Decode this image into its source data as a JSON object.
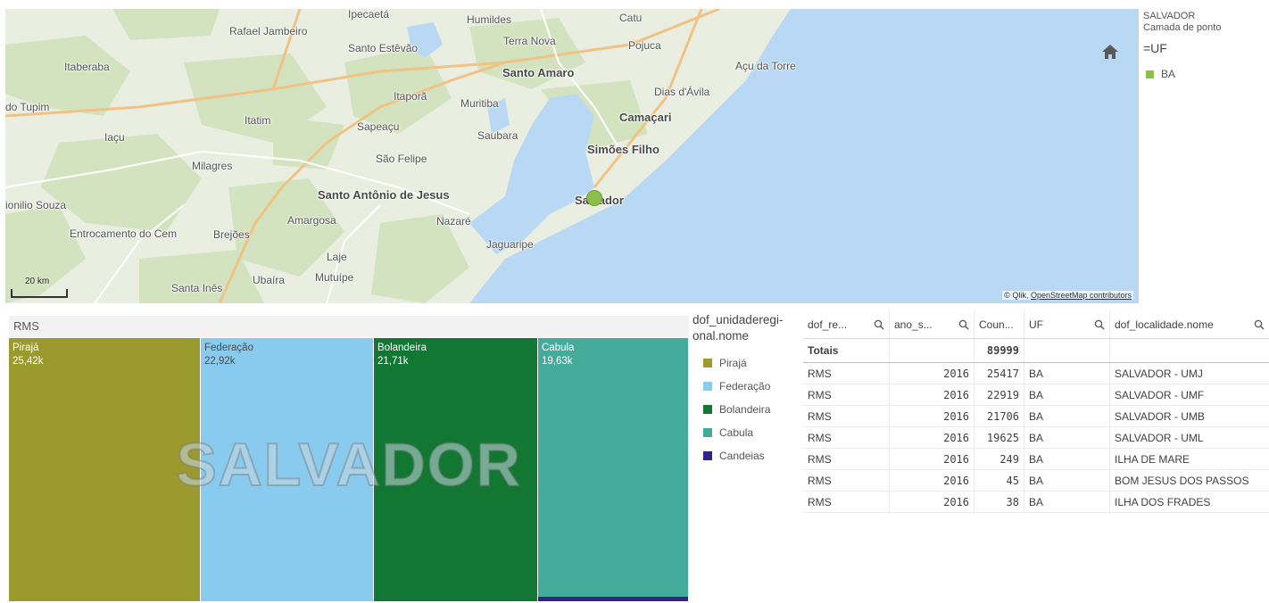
{
  "map": {
    "places": [
      {
        "name": "Ipecaetá",
        "city": false
      },
      {
        "name": "Humildes",
        "city": false
      },
      {
        "name": "Catu",
        "city": false
      },
      {
        "name": "Rafael Jambeiro",
        "city": false
      },
      {
        "name": "Santo Estêvão",
        "city": false
      },
      {
        "name": "Terra Nova",
        "city": false
      },
      {
        "name": "Pojuca",
        "city": false
      },
      {
        "name": "Itaberaba",
        "city": false
      },
      {
        "name": "Santo Amaro",
        "city": true
      },
      {
        "name": "Açu da Torre",
        "city": false
      },
      {
        "name": "Dias d'Ávila",
        "city": false
      },
      {
        "name": "do Tupim",
        "city": false
      },
      {
        "name": "Itaporã",
        "city": false
      },
      {
        "name": "Muritiba",
        "city": false
      },
      {
        "name": "Itatim",
        "city": false
      },
      {
        "name": "Camaçari",
        "city": true
      },
      {
        "name": "Sapeaçu",
        "city": false
      },
      {
        "name": "Iaçu",
        "city": false
      },
      {
        "name": "Saubara",
        "city": false
      },
      {
        "name": "Simões Filho",
        "city": true
      },
      {
        "name": "São Felipe",
        "city": false
      },
      {
        "name": "Milagres",
        "city": false
      },
      {
        "name": "Santo Antônio de Jesus",
        "city": true
      },
      {
        "name": "Salvador",
        "city": true
      },
      {
        "name": "ionilio Souza",
        "city": false
      },
      {
        "name": "Amargosa",
        "city": false
      },
      {
        "name": "Nazaré",
        "city": false
      },
      {
        "name": "Entrocamento do Cem",
        "city": false
      },
      {
        "name": "Brejões",
        "city": false
      },
      {
        "name": "Jaguaripe",
        "city": false
      },
      {
        "name": "Laje",
        "city": false
      },
      {
        "name": "Ubaíra",
        "city": false
      },
      {
        "name": "Mutuípe",
        "city": false
      },
      {
        "name": "Santa Inês",
        "city": false
      }
    ],
    "scale_label": "20 km",
    "attribution_prefix": "© Qlik, ",
    "attribution_link": "OpenStreetMap contributors",
    "point_color": "#8bc04a"
  },
  "map_legend": {
    "title": "SALVADOR",
    "subtitle": "Camada de ponto",
    "dimension": "=UF",
    "items": [
      {
        "label": "BA",
        "color": "#8bc04a"
      }
    ]
  },
  "treemap": {
    "header": "RMS",
    "watermark": "SALVADOR",
    "tiles": [
      {
        "label": "Pirajá",
        "value": "25,42k",
        "amount": 25417,
        "color": "#9a9a2f",
        "light": false
      },
      {
        "label": "Federação",
        "value": "22,92k",
        "amount": 22919,
        "color": "#88cbee",
        "light": true
      },
      {
        "label": "Bolandeira",
        "value": "21,71k",
        "amount": 21706,
        "color": "#117733",
        "light": false
      },
      {
        "label": "Cabula",
        "value": "19,63k",
        "amount": 19625,
        "color": "#44aa99",
        "light": false
      },
      {
        "label": "Candeias",
        "value": "",
        "amount": 332,
        "color": "#332288",
        "light": false
      }
    ]
  },
  "treemap_legend": {
    "title": "dof_unidaderegi-onal.nome",
    "items": [
      {
        "label": "Pirajá",
        "color": "#9a9a2f"
      },
      {
        "label": "Federação",
        "color": "#88cbee"
      },
      {
        "label": "Bolandeira",
        "color": "#117733"
      },
      {
        "label": "Cabula",
        "color": "#44aa99"
      },
      {
        "label": "Candeias",
        "color": "#332288"
      }
    ]
  },
  "table": {
    "headers": [
      "dof_re...",
      "ano_s...",
      "Coun...",
      "UF",
      "dof_localidade.nome"
    ],
    "totals": {
      "label": "Totais",
      "count": "89999"
    },
    "rows": [
      [
        "RMS",
        "2016",
        "25417",
        "BA",
        "SALVADOR - UMJ"
      ],
      [
        "RMS",
        "2016",
        "22919",
        "BA",
        "SALVADOR - UMF"
      ],
      [
        "RMS",
        "2016",
        "21706",
        "BA",
        "SALVADOR - UMB"
      ],
      [
        "RMS",
        "2016",
        "19625",
        "BA",
        "SALVADOR - UML"
      ],
      [
        "RMS",
        "2016",
        "249",
        "BA",
        "ILHA DE MARE"
      ],
      [
        "RMS",
        "2016",
        "45",
        "BA",
        "BOM JESUS DOS PASSOS"
      ],
      [
        "RMS",
        "2016",
        "38",
        "BA",
        "ILHA DOS FRADES"
      ]
    ]
  }
}
